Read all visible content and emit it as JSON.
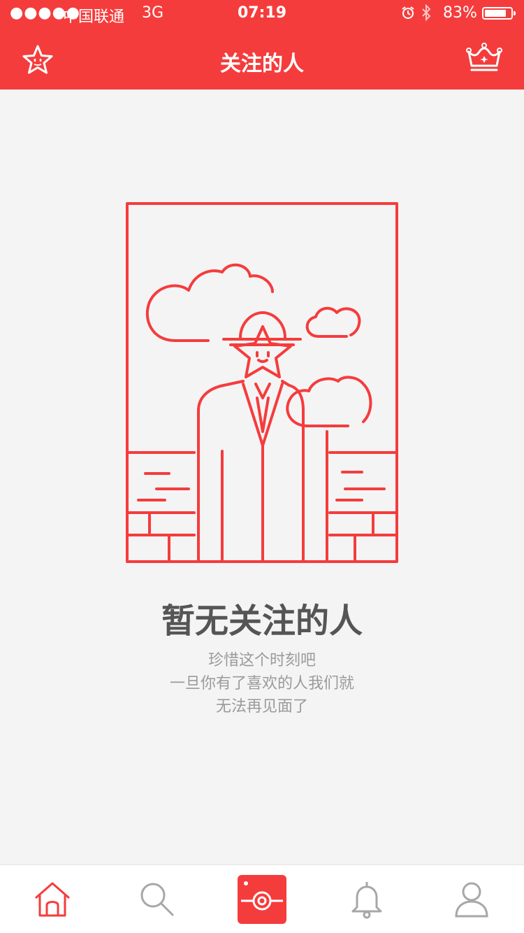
{
  "status_bar": {
    "signal": "●●●●●",
    "carrier": "中国联通",
    "network": "3G",
    "time": "07:19",
    "battery_text": "83%",
    "battery_level": 0.83,
    "icons": [
      "alarm-icon",
      "bluetooth-icon",
      "battery-icon"
    ]
  },
  "nav": {
    "title": "关注的人",
    "left_icon": "star-face-icon",
    "right_icon": "crown-icon"
  },
  "empty_state": {
    "illustration": "man-with-star-face-illustration",
    "title": "暂无关注的人",
    "line1": "珍惜这个时刻吧",
    "line2": "一旦你有了喜欢的人我们就",
    "line3": "无法再见面了"
  },
  "tabbar": {
    "tabs": [
      {
        "icon": "home-icon",
        "active": true
      },
      {
        "icon": "search-icon",
        "active": false
      },
      {
        "icon": "camera-icon",
        "active": false
      },
      {
        "icon": "bell-icon",
        "active": false
      },
      {
        "icon": "profile-icon",
        "active": false
      }
    ]
  },
  "colors": {
    "accent": "#f53c3c",
    "background": "#f4f4f5",
    "tab_inactive": "#a7a7a7"
  }
}
